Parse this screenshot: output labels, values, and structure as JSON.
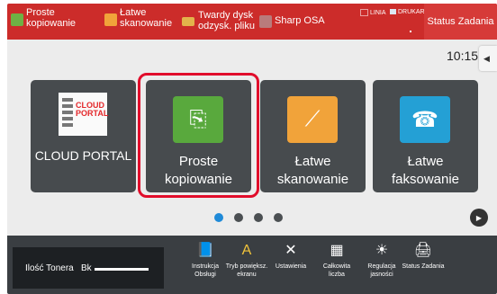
{
  "topbar": {
    "shortcuts": [
      {
        "label": "Proste\nkopiowanie",
        "icon": "copy-icon"
      },
      {
        "label": "Łatwe\nskanowanie",
        "icon": "scan-icon"
      },
      {
        "label": "Twardy dysk\nodzysk. pliku",
        "icon": "folder-icon"
      },
      {
        "label": "Sharp OSA",
        "icon": "osa-icon"
      }
    ],
    "indicators": [
      "LINIA",
      "DRUKARK"
    ],
    "status_button": "Status Zadania"
  },
  "clock": "10:15",
  "tiles": [
    {
      "label": "CLOUD PORTAL",
      "logo_text": "CLOUD\nPORTAL"
    },
    {
      "label": "Proste\nkopiowanie"
    },
    {
      "label": "Łatwe\nskanowanie"
    },
    {
      "label": "Łatwe\nfaksowanie"
    }
  ],
  "pager": {
    "pages": 4,
    "current": 1
  },
  "bottombar": {
    "toner_label": "Ilość Tonera",
    "toner_color": "Bk",
    "items": [
      {
        "label": "Instrukcja\nObsługi",
        "icon": "manual-icon"
      },
      {
        "label": "Tryb powiększ.\nekranu",
        "icon": "enlarge-display-icon"
      },
      {
        "label": "Ustawienia",
        "icon": "settings-icon"
      },
      {
        "label": "Całkowita\nliczba",
        "icon": "counter-icon"
      },
      {
        "label": "Regulacja\njasności",
        "icon": "brightness-icon"
      },
      {
        "label": "Status Zadania",
        "icon": "job-status-icon"
      }
    ]
  },
  "colors": {
    "topbar": "#cc2c2a",
    "highlight": "#e10d2b",
    "pager_active": "#1f8ad8"
  }
}
